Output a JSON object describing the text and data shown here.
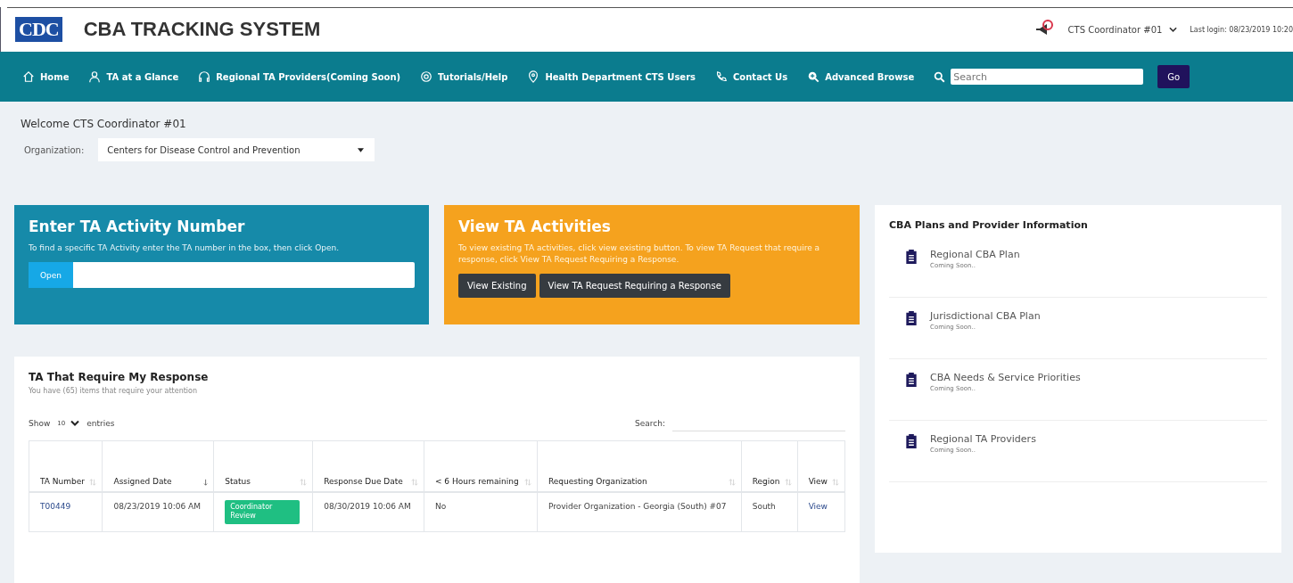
{
  "header": {
    "logo": "CDC",
    "title": "CBA TRACKING SYSTEM",
    "user": "CTS Coordinator #01",
    "last_login": "Last login: 08/23/2019 10:20"
  },
  "nav": {
    "items": [
      {
        "label": "Home"
      },
      {
        "label": "TA at a Glance"
      },
      {
        "label": "Regional TA Providers(Coming Soon)"
      },
      {
        "label": "Tutorials/Help"
      },
      {
        "label": "Health Department CTS Users"
      },
      {
        "label": "Contact Us"
      },
      {
        "label": "Advanced Browse"
      }
    ],
    "search": {
      "placeholder": "Search",
      "button": "Go"
    }
  },
  "welcome": "Welcome CTS Coordinator #01",
  "organization": {
    "label": "Organization:",
    "value": "Centers for Disease Control and Prevention"
  },
  "enter_card": {
    "title": "Enter TA Activity Number",
    "text": "To find a specific TA Activity enter the TA number in the box, then click Open.",
    "button": "Open"
  },
  "view_card": {
    "title": "View TA Activities",
    "text": "To view existing TA activities, click view existing button. To view TA Request that require a response, click View TA Request Requiring a Response.",
    "buttons": [
      "View Existing",
      "View TA Request Requiring a Response"
    ]
  },
  "plans": {
    "title": "CBA Plans and Provider Information",
    "items": [
      {
        "title": "Regional CBA Plan",
        "note": "Coming Soon.."
      },
      {
        "title": "Jurisdictional CBA Plan",
        "note": "Coming Soon.."
      },
      {
        "title": "CBA Needs & Service Priorities",
        "note": "Coming Soon.."
      },
      {
        "title": "Regional TA Providers",
        "note": "Coming Soon.."
      }
    ]
  },
  "table_card": {
    "title": "TA That Require My Response",
    "subtitle": "You have (65) items that require your attention",
    "show": "Show",
    "page_size": "10",
    "entries": "entries",
    "search_label": "Search:",
    "columns": [
      {
        "label": "TA Number",
        "sorted": false
      },
      {
        "label": "Assigned Date",
        "sorted": true
      },
      {
        "label": "Status",
        "sorted": false
      },
      {
        "label": "Response Due Date",
        "sorted": false
      },
      {
        "label": "< 6 Hours remaining",
        "sorted": false
      },
      {
        "label": "Requesting Organization",
        "sorted": false
      },
      {
        "label": "Region",
        "sorted": false
      },
      {
        "label": "View",
        "sorted": false
      }
    ],
    "rows": [
      {
        "ta": "T00449",
        "assigned": "08/23/2019 10:06 AM",
        "status": "Coordinator Review",
        "due": "08/30/2019 10:06 AM",
        "under_6": "No",
        "org": "Provider Organization - Georgia (South) #07",
        "region": "South",
        "view": "View"
      }
    ]
  }
}
